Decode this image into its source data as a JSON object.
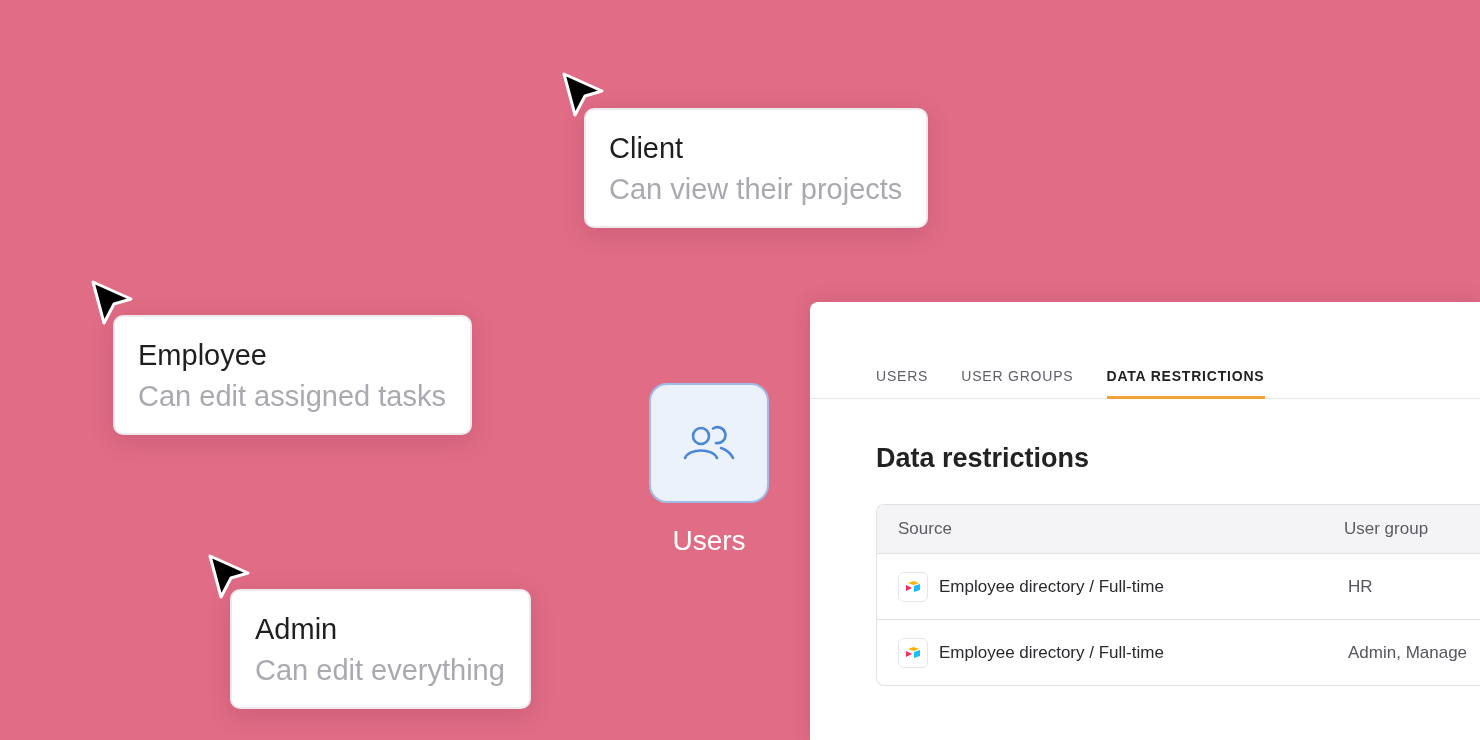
{
  "role_cards": [
    {
      "title": "Client",
      "description": "Can view their projects"
    },
    {
      "title": "Employee",
      "description": "Can edit assigned tasks"
    },
    {
      "title": "Admin",
      "description": "Can edit everything"
    }
  ],
  "app_tile": {
    "label": "Users"
  },
  "panel": {
    "tabs": [
      {
        "label": "USERS",
        "selected": false
      },
      {
        "label": "USER GROUPS",
        "selected": false
      },
      {
        "label": "DATA RESTRICTIONS",
        "selected": true
      }
    ],
    "heading": "Data restrictions",
    "table": {
      "columns": [
        "Source",
        "User group"
      ],
      "rows": [
        {
          "source": "Employee directory / Full-time",
          "user_group": "HR"
        },
        {
          "source": "Employee directory / Full-time",
          "user_group": "Admin, Manage"
        }
      ]
    }
  }
}
